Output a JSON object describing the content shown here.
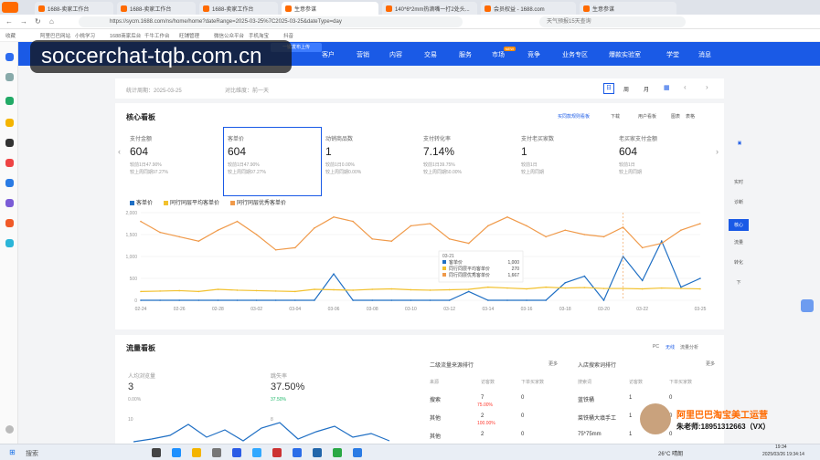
{
  "browser": {
    "tabs": [
      {
        "label": "1688-卖家工作台"
      },
      {
        "label": "1688-卖家工作台"
      },
      {
        "label": "1688-卖家工作台"
      },
      {
        "label": "生意参谋"
      },
      {
        "label": "140*6*2mm热滴嘴一打2处头..."
      },
      {
        "label": "会员权益 - 1688.com"
      },
      {
        "label": "生意参谋"
      }
    ],
    "url": "https://sycm.1688.com/ns/home/home?dateRange=2025-03-25%7C2025-03-25&dateType=day",
    "search_placeholder": "天气预报15天查询",
    "bookmarks": [
      "收藏",
      "阿里巴巴网站",
      "小桃学习",
      "1688商家后台",
      "千牛工作台",
      "旺铺管理",
      "微信公众平台",
      "手机淘宝",
      "抖音"
    ]
  },
  "nav": {
    "items": [
      "客户",
      "营销",
      "内容",
      "交易",
      "服务",
      "市场",
      "竞争",
      "业务专区",
      "爆款实验室",
      "学堂",
      "消息"
    ],
    "new_badge": "NEW",
    "floating": "一键发布上传"
  },
  "watermark": "soccerchat-tqb.com.cn",
  "stat_bar": {
    "period": "统计周期：2025-03-25",
    "compare": "对比维度：前一天",
    "day": "日",
    "week": "周",
    "month": "月"
  },
  "core": {
    "title": "核心看板",
    "links": [
      "买同款规则看板",
      "下载",
      "用户看板",
      "图表",
      "表格"
    ],
    "kpis": [
      {
        "label": "支付金额",
        "value": "604",
        "s1": "较前1日47.90%",
        "s2": "较上周同期97.27%"
      },
      {
        "label": "客单价",
        "value": "604",
        "s1": "较前1日47.90%",
        "s2": "较上周同期97.27%"
      },
      {
        "label": "动销商品数",
        "value": "1",
        "s1": "较前1日0.00%",
        "s2": "较上周同期0.00%"
      },
      {
        "label": "支付转化率",
        "value": "7.14%",
        "s1": "较前1日39.75%",
        "s2": "较上周同期50.00%"
      },
      {
        "label": "支付老买家数",
        "value": "1",
        "s1": "较前1日",
        "s2": "较上周同期"
      },
      {
        "label": "老买家支付金额",
        "value": "604",
        "s1": "较前1日",
        "s2": "较上周同期"
      }
    ],
    "legend": [
      "客单价",
      "同行同层平均客单价",
      "同行同层优秀客单价"
    ],
    "tooltip": {
      "date": "03-21",
      "rows": [
        [
          "客单价",
          "1,000"
        ],
        [
          "同行同层平均客单价",
          "270"
        ],
        [
          "同行同层优秀客单价",
          "1,667"
        ]
      ]
    }
  },
  "traffic": {
    "title": "流量看板",
    "links": [
      "PC",
      "无线",
      "流量分析"
    ],
    "kpi1": {
      "label": "人均浏览量",
      "value": "3",
      "sub": "0.00%"
    },
    "kpi2": {
      "label": "跳失率",
      "value": "37.50%",
      "sub": "37.50%"
    },
    "chart_ticks": [
      "10",
      "8"
    ],
    "table1": {
      "title": "二级流量来源排行",
      "more": "更多",
      "cols": [
        "来源",
        "访客数",
        "下单买家数"
      ],
      "rows": [
        [
          "搜索",
          "7",
          "0"
        ],
        [
          "其他",
          "2",
          "0"
        ],
        [
          "其他",
          "2",
          "0"
        ]
      ],
      "notes": [
        "75.00%",
        "100.00%"
      ]
    },
    "table2": {
      "title": "入店搜索词排行",
      "more": "更多",
      "cols": [
        "搜索词",
        "访客数",
        "下单买家数"
      ],
      "rows": [
        [
          "蓝铁桶",
          "1",
          "0"
        ],
        [
          "菜铁桶大填手工",
          "1",
          "0"
        ],
        [
          "75*75mm",
          "1",
          "0"
        ]
      ]
    }
  },
  "right_tabs": [
    "实时",
    "诊断",
    "核心",
    "流量",
    "转化",
    "下"
  ],
  "promo": {
    "line1": "阿里巴巴淘宝美工运营",
    "line2": "朱老师:18951312663（VX）"
  },
  "taskbar": {
    "search": "搜索",
    "weather": "26°C 晴朗",
    "time": "19:34",
    "date": "2025/03/26 19:34:14"
  },
  "colors": {
    "primary": "#1a5ae6",
    "series1": "#1f6fc4",
    "series2": "#f2c12e",
    "series3": "#f09a4a"
  },
  "chart_data": {
    "type": "line",
    "x": [
      "02-24",
      "02-25",
      "02-26",
      "02-27",
      "02-28",
      "03-01",
      "03-02",
      "03-03",
      "03-04",
      "03-05",
      "03-06",
      "03-07",
      "03-08",
      "03-09",
      "03-10",
      "03-11",
      "03-12",
      "03-13",
      "03-14",
      "03-15",
      "03-16",
      "03-17",
      "03-18",
      "03-19",
      "03-20",
      "03-21",
      "03-22",
      "03-23",
      "03-24",
      "03-25"
    ],
    "xticks": [
      "02-24",
      "02-26",
      "02-28",
      "03-02",
      "03-04",
      "03-06",
      "03-08",
      "03-10",
      "03-12",
      "03-14",
      "03-16",
      "03-18",
      "03-20",
      "03-22",
      "03-25"
    ],
    "yticks": [
      "0",
      "500",
      "1,000",
      "1,500",
      "2,000"
    ],
    "ylim": [
      0,
      2000
    ],
    "series": [
      {
        "name": "客单价",
        "values": [
          0,
          0,
          0,
          0,
          0,
          0,
          0,
          0,
          0,
          0,
          600,
          0,
          0,
          0,
          0,
          0,
          0,
          200,
          0,
          0,
          0,
          0,
          400,
          550,
          0,
          1000,
          450,
          1350,
          300,
          500
        ]
      },
      {
        "name": "同行同层平均客单价",
        "values": [
          200,
          210,
          220,
          200,
          250,
          230,
          220,
          210,
          200,
          250,
          240,
          230,
          250,
          260,
          240,
          230,
          240,
          250,
          300,
          280,
          260,
          300,
          280,
          290,
          270,
          270,
          260,
          280,
          270,
          260
        ]
      },
      {
        "name": "同行同层优秀客单价",
        "values": [
          1800,
          1550,
          1450,
          1350,
          1600,
          1800,
          1500,
          1150,
          1200,
          1650,
          1900,
          1800,
          1400,
          1350,
          1700,
          1750,
          1400,
          1300,
          1700,
          1900,
          1700,
          1450,
          1600,
          1500,
          1450,
          1667,
          1200,
          1300,
          1600,
          1750
        ]
      }
    ]
  }
}
